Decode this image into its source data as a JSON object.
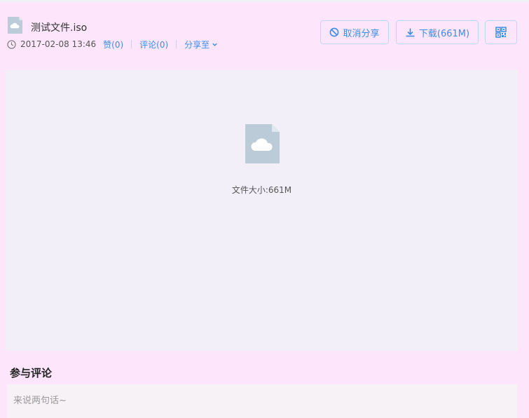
{
  "file": {
    "name": "测试文件.iso",
    "icon": "cloud-file-icon",
    "icon_color": "#bccbd8"
  },
  "meta": {
    "datetime": "2017-02-08 13:46",
    "like_label": "赞(0)",
    "comment_label": "评论(0)",
    "share_label": "分享至"
  },
  "actions": {
    "cancel_share_label": "取消分享",
    "download_label": "下载(661M)",
    "qr_icon": "qr-code-icon"
  },
  "preview": {
    "size_label": "文件大小:661M"
  },
  "comments": {
    "title": "参与评论",
    "placeholder": "来说两句话~"
  },
  "colors": {
    "accent": "#3a8ee6",
    "page_bg": "#fde6fb",
    "preview_bg": "#f3eff8"
  }
}
